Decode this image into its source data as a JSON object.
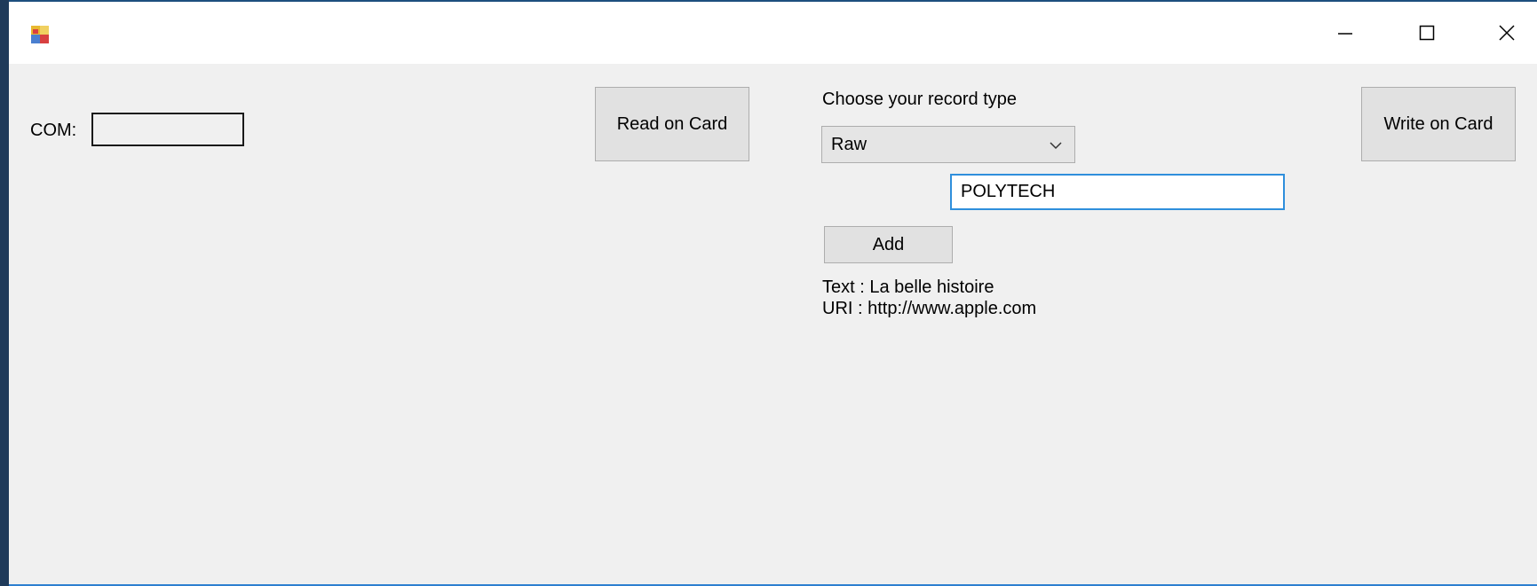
{
  "window": {
    "icons": {
      "app": "app-icon",
      "minimize": "minimize-icon",
      "maximize": "maximize-icon",
      "close": "close-icon"
    }
  },
  "form": {
    "com_label": "COM:",
    "com_value": "",
    "read_button": "Read on Card",
    "write_button": "Write on Card",
    "record_type_label": "Choose your record type",
    "record_type_selected": "Raw",
    "record_input_value": "POLYTECH",
    "add_button": "Add",
    "records": [
      "Text : La belle histoire",
      "URI : http://www.apple.com"
    ]
  },
  "colors": {
    "window_bg": "#f0f0f0",
    "title_bar_bg": "#ffffff",
    "button_bg": "#e1e1e1",
    "focus_border": "#2f8fdc"
  }
}
